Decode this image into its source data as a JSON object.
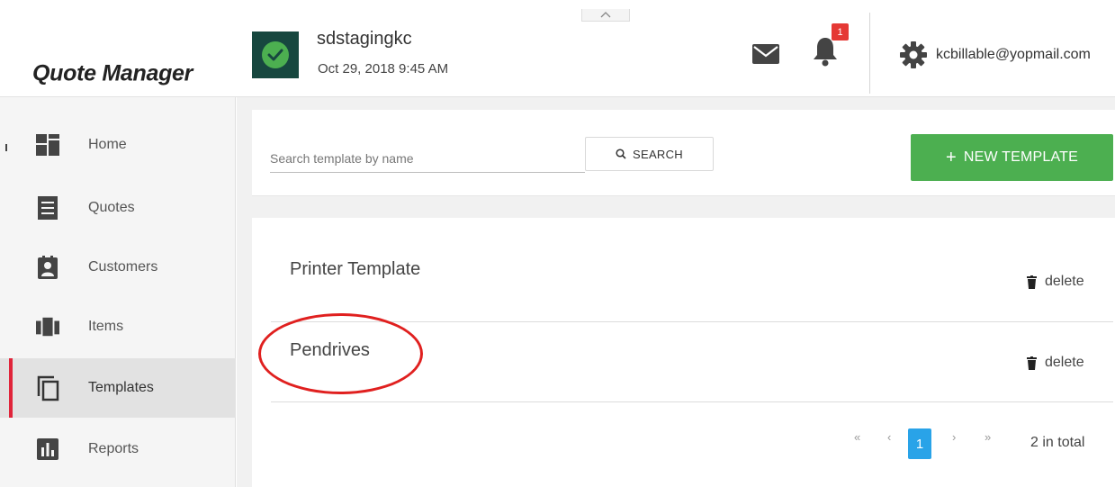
{
  "app": {
    "title": "Quote Manager"
  },
  "header": {
    "company_name": "sdstagingkc",
    "company_date": "Oct 29, 2018 9:45 AM",
    "notification_count": "1",
    "user_email": "kcbillable@yopmail.com",
    "collapse_glyph": "^"
  },
  "sidebar": {
    "items": [
      {
        "label": "Home",
        "icon": "home-icon"
      },
      {
        "label": "Quotes",
        "icon": "quotes-icon"
      },
      {
        "label": "Customers",
        "icon": "customers-icon"
      },
      {
        "label": "Items",
        "icon": "items-icon"
      },
      {
        "label": "Templates",
        "icon": "templates-icon",
        "active": true
      },
      {
        "label": "Reports",
        "icon": "reports-icon"
      }
    ]
  },
  "search": {
    "placeholder": "Search template by name",
    "value": "",
    "button_label": "SEARCH"
  },
  "actions": {
    "new_template_label": "NEW TEMPLATE"
  },
  "templates": {
    "rows": [
      {
        "name": "Printer Template",
        "delete_label": "delete"
      },
      {
        "name": "Pendrives",
        "delete_label": "delete"
      }
    ]
  },
  "pagination": {
    "first": "«",
    "prev": "‹",
    "current": "1",
    "next": "›",
    "last": "»",
    "total_text": "2 in total"
  },
  "colors": {
    "brand_green": "#4caf50",
    "logo_bg": "#17473f",
    "active_accent": "#e0243a",
    "badge_red": "#e53935",
    "page_active": "#29a3e8",
    "annotation_ring": "#e0201f"
  }
}
